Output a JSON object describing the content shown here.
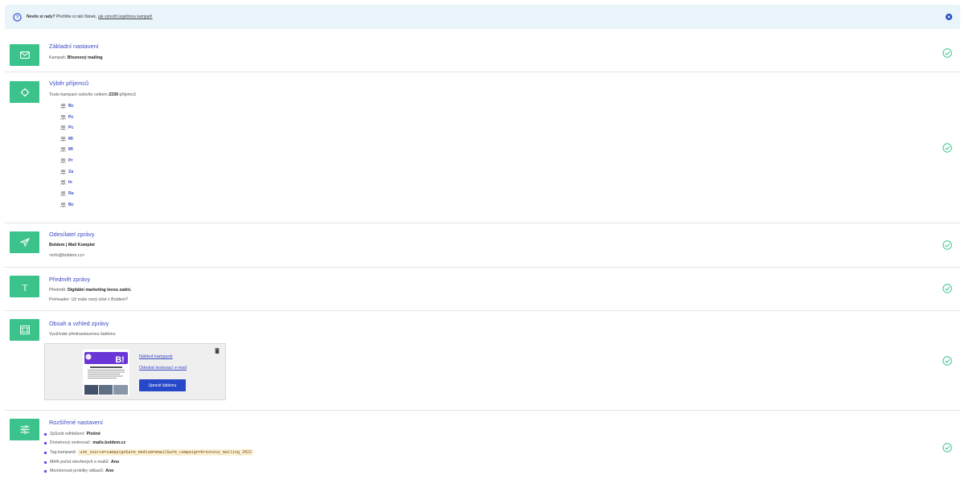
{
  "info_bar": {
    "bold_text": "Nevíte si rady?",
    "text": "Přečtěte si náš článek,",
    "link_text": "jak vytvořit úspěšnou kampaň!"
  },
  "basic": {
    "title": "Základní nastavení",
    "campaign_label": "Kampaň:",
    "campaign_value": "Březnový mailing"
  },
  "recipients": {
    "title": "Výběr příjemců",
    "text_prefix": "Touto kampaní oslovíte celkem",
    "count": "2339",
    "text_suffix": "příjemců",
    "groups": [
      "Bc",
      "Pc",
      "Pc",
      "Ml",
      "Ml",
      "Pr",
      "Za",
      "In",
      "Re",
      "Bc"
    ]
  },
  "sender": {
    "title": "Odesílatel zprávy",
    "name": "Boldem | Mail Komplet",
    "email": "<info@boldem.cz>"
  },
  "subject": {
    "title": "Předmět zprávy",
    "subject_label": "Předmět:",
    "subject_value": "Digitální marketing levou zadní.",
    "preheader_label": "Preheader:",
    "preheader_value": "Už máte nový účet v Boldem?"
  },
  "content": {
    "title": "Obsah a vzhled zprávy",
    "text": "Využíváte přednastavenou šablonu",
    "preview_link": "Náhled kampaně",
    "test_link": "Odeslat testovací e-mail",
    "edit_button": "Upravit šablonu",
    "thumb_text": "B!"
  },
  "advanced": {
    "title": "Rozšířené nastavení",
    "items": [
      {
        "label": "Způsob odhlášení:",
        "value": "Plošné"
      },
      {
        "label": "Doménový směrovač:",
        "value": "mails.boldem.cz"
      },
      {
        "label": "Tag kampaně:",
        "value": "utm_source=campaign&utm_medium=email&utm_campaign=breznovy_mailing_2022"
      },
      {
        "label": "Měřit počet otevřených e-mailů:",
        "value": "Ano"
      },
      {
        "label": "Monitorovat prokliky odkazů:",
        "value": "Ano"
      }
    ]
  },
  "colors": {
    "tile": "#3cc38b",
    "title": "#3b49c4",
    "check": "#3cc38b",
    "button": "#2748c9"
  }
}
